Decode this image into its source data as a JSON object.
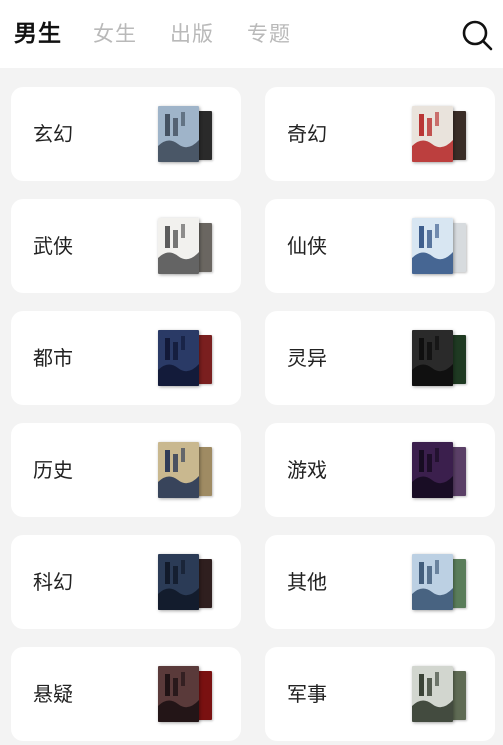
{
  "tabs": [
    {
      "label": "男生",
      "active": true
    },
    {
      "label": "女生",
      "active": false
    },
    {
      "label": "出版",
      "active": false
    },
    {
      "label": "专题",
      "active": false
    }
  ],
  "search": {
    "icon": "search-icon"
  },
  "categories": [
    {
      "label": "玄幻",
      "front": "#9fb4c9",
      "front_dark": "#3b4756",
      "back": "#2a2a2a"
    },
    {
      "label": "奇幻",
      "front": "#e9e3dc",
      "front_dark": "#b42222",
      "back": "#3a2d27"
    },
    {
      "label": "武侠",
      "front": "#f2f1ee",
      "front_dark": "#4b4b4b",
      "back": "#6a6661"
    },
    {
      "label": "仙侠",
      "front": "#d8e6f2",
      "front_dark": "#2d4f82",
      "back": "#d7dbde"
    },
    {
      "label": "都市",
      "front": "#2a3a66",
      "front_dark": "#0f1633",
      "back": "#7a1f1f"
    },
    {
      "label": "灵异",
      "front": "#2a2a2a",
      "front_dark": "#0c0c0c",
      "back": "#1f3a22"
    },
    {
      "label": "历史",
      "front": "#c9b88f",
      "front_dark": "#1f2f52",
      "back": "#9f8b63"
    },
    {
      "label": "游戏",
      "front": "#3b1f4d",
      "front_dark": "#140a1e",
      "back": "#5a3f66"
    },
    {
      "label": "科幻",
      "front": "#2b3b56",
      "front_dark": "#0f1726",
      "back": "#2f1f1f"
    },
    {
      "label": "其他",
      "front": "#bcd0e3",
      "front_dark": "#345070",
      "back": "#5a7d5a"
    },
    {
      "label": "悬疑",
      "front": "#5a3a3a",
      "front_dark": "#1a0f12",
      "back": "#7a1111"
    },
    {
      "label": "军事",
      "front": "#d2d6cf",
      "front_dark": "#2a3326",
      "back": "#5f6b54"
    }
  ]
}
